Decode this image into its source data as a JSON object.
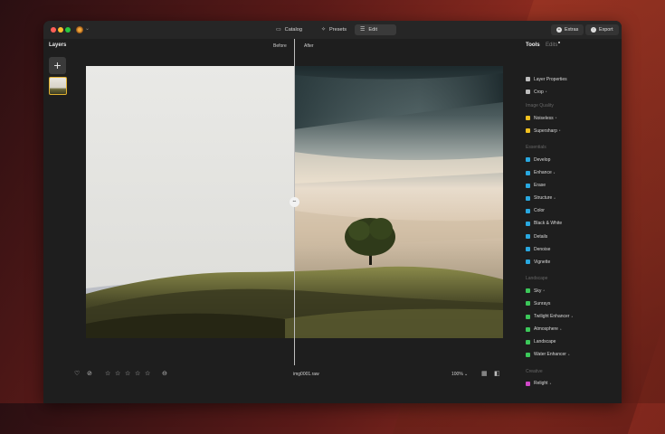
{
  "window": {
    "tabs": [
      {
        "label": "Catalog",
        "icon": "catalog-icon"
      },
      {
        "label": "Presets",
        "icon": "presets-icon"
      },
      {
        "label": "Edit",
        "icon": "sliders-icon"
      }
    ],
    "active_tab": "Edit",
    "extras_label": "Extras",
    "export_label": "Export"
  },
  "layers": {
    "title": "Layers"
  },
  "compare": {
    "before_label": "Before",
    "after_label": "After"
  },
  "bottom": {
    "filename": "img0001.raw",
    "zoom": "100%",
    "rating_stars": 5,
    "rating_filled": 0
  },
  "sidebar": {
    "tab_tools": "Tools",
    "tab_edits": "Edits",
    "top_items": [
      {
        "label": "Layer Properties",
        "icon": "layers-icon",
        "color": "#bdbdbd",
        "starred": false
      },
      {
        "label": "Crop",
        "icon": "crop-icon",
        "color": "#bdbdbd",
        "starred": true
      }
    ],
    "sections": [
      {
        "title": "Image Quality",
        "items": [
          {
            "label": "Noiseless",
            "icon": "noiseless-icon",
            "color": "#f0c020",
            "starred": true
          },
          {
            "label": "Supersharp",
            "icon": "supersharp-icon",
            "color": "#f0c020",
            "starred": true
          }
        ]
      },
      {
        "title": "Essentials",
        "items": [
          {
            "label": "Develop",
            "icon": "develop-icon",
            "color": "#29a8e0",
            "starred": false
          },
          {
            "label": "Enhance",
            "icon": "enhance-icon",
            "color": "#29a8e0",
            "starred": true
          },
          {
            "label": "Erase",
            "icon": "erase-icon",
            "color": "#29a8e0",
            "starred": false
          },
          {
            "label": "Structure",
            "icon": "structure-icon",
            "color": "#29a8e0",
            "starred": true
          },
          {
            "label": "Color",
            "icon": "color-icon",
            "color": "#29a8e0",
            "starred": false
          },
          {
            "label": "Black & White",
            "icon": "bw-icon",
            "color": "#29a8e0",
            "starred": false
          },
          {
            "label": "Details",
            "icon": "details-icon",
            "color": "#29a8e0",
            "starred": false
          },
          {
            "label": "Denoise",
            "icon": "denoise-icon",
            "color": "#29a8e0",
            "starred": false
          },
          {
            "label": "Vignette",
            "icon": "vignette-icon",
            "color": "#29a8e0",
            "starred": false
          }
        ]
      },
      {
        "title": "Landscape",
        "items": [
          {
            "label": "Sky",
            "icon": "sky-icon",
            "color": "#3cc85a",
            "starred": true
          },
          {
            "label": "Sunrays",
            "icon": "sunrays-icon",
            "color": "#3cc85a",
            "starred": false
          },
          {
            "label": "Twilight Enhancer",
            "icon": "twilight-icon",
            "color": "#3cc85a",
            "starred": true
          },
          {
            "label": "Atmosphere",
            "icon": "atmosphere-icon",
            "color": "#3cc85a",
            "starred": true
          },
          {
            "label": "Landscape",
            "icon": "landscape-icon",
            "color": "#3cc85a",
            "starred": false
          },
          {
            "label": "Water Enhancer",
            "icon": "water-icon",
            "color": "#3cc85a",
            "starred": true
          }
        ]
      },
      {
        "title": "Creative",
        "items": [
          {
            "label": "Relight",
            "icon": "relight-icon",
            "color": "#d048c8",
            "starred": true
          }
        ]
      }
    ]
  }
}
